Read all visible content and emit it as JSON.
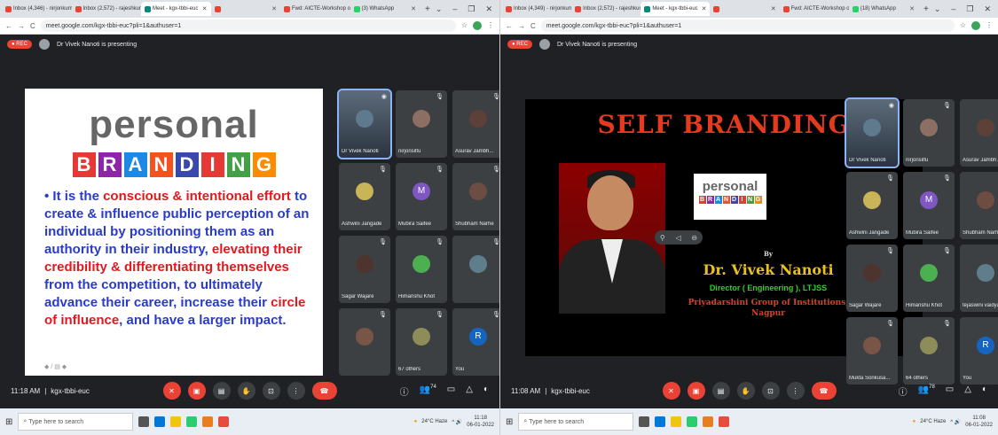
{
  "windows": [
    {
      "tabs": [
        {
          "label": "Inbox (4,346) - nirjonkumar",
          "color": "#ea4335"
        },
        {
          "label": "Inbox (2,572) - rajeshkumar",
          "color": "#ea4335"
        },
        {
          "label": "Meet - kgx-tbbi-euc",
          "color": "#00897b",
          "active": true
        },
        {
          "label": "",
          "color": "#ea4335"
        },
        {
          "label": "Fwd: AICTE-Workshop on ...",
          "color": "#ea4335"
        },
        {
          "label": "(3) WhatsApp",
          "color": "#25d366"
        }
      ],
      "url": "meet.google.com/kgx-tbbi-euc?pli=1&authuser=1",
      "presenting": "Dr Vivek Nanoti is presenting",
      "rec": "REC",
      "tiles": [
        "Dr Vivek Nanoti",
        "nirjonsilfu",
        "Asurav Jambh...",
        "Ashwini Jangade",
        "Mubira Saifee",
        "Shubham Narhe",
        "Sagar Wajare",
        "Himanshu Khot",
        "",
        "",
        "67 others",
        "You"
      ],
      "time": "11:18 AM",
      "code": "kgx-tbbi-euc",
      "participants_badge": "74",
      "date": "06-01-2022",
      "clock": "11:18"
    },
    {
      "tabs": [
        {
          "label": "Inbox (4,349) - nirjonkumar",
          "color": "#ea4335"
        },
        {
          "label": "Inbox (2,572) - rajeshkumar",
          "color": "#ea4335"
        },
        {
          "label": "Meet - kgx-tbbi-euc",
          "color": "#00897b",
          "active": true
        },
        {
          "label": "",
          "color": "#ea4335"
        },
        {
          "label": "Fwd: AICTE-Workshop on ...",
          "color": "#ea4335"
        },
        {
          "label": "(18) WhatsApp",
          "color": "#25d366"
        }
      ],
      "url": "meet.google.com/kgx-tbbi-euc?pli=1&authuser=1",
      "presenting": "Dr Vivek Nanoti is presenting",
      "rec": "REC",
      "tiles": [
        "Dr Vivek Nanoti",
        "nirjonsilfu",
        "Asurav Jambh...",
        "Ashwini Jangade",
        "Mubira Saifee",
        "Shubham Narhe",
        "Sagar Wajare",
        "Himanshu Khot",
        "tejaswini vaidya",
        "Mukta Sonkusa...",
        "64 others",
        "You"
      ],
      "time": "11:08 AM",
      "code": "kgx-tbbi-euc",
      "participants_badge": "78",
      "date": "06-01-2022",
      "clock": "11:08"
    }
  ],
  "slideA": {
    "title": "personal",
    "branding_letters": [
      "B",
      "R",
      "A",
      "N",
      "D",
      "I",
      "N",
      "G"
    ],
    "branding_colors": [
      "#e53935",
      "#8e24aa",
      "#1e88e5",
      "#f4511e",
      "#3949ab",
      "#e53935",
      "#43a047",
      "#fb8c00"
    ],
    "bullet_parts": [
      {
        "t": "• It is the ",
        "red": false
      },
      {
        "t": "conscious & intentional effort",
        "red": true
      },
      {
        "t": " to create & influence public perception of an individual by positioning them as an authority in their industry, ",
        "red": false
      },
      {
        "t": "elevating their credibility & differentiating themselves",
        "red": true
      },
      {
        "t": " from the competition, to ultimately advance their career, increase their ",
        "red": false
      },
      {
        "t": "circle of influence",
        "red": true
      },
      {
        "t": ", and have a larger impact.",
        "red": false
      }
    ],
    "footer_icons": "◆ / ▤ ◆"
  },
  "slideB": {
    "title": "SELF BRANDING",
    "mini_title": "personal",
    "by": "By",
    "name": "Dr. Vivek Nanoti",
    "role": "Director ( Engineering ), LTJSS",
    "org": "Priyadarshini Group of Institutions, Nagpur"
  },
  "taskbar": {
    "search": "Type here to search",
    "weather": "24°C Haze"
  },
  "avatar_m": "M",
  "avatar_r": "R"
}
